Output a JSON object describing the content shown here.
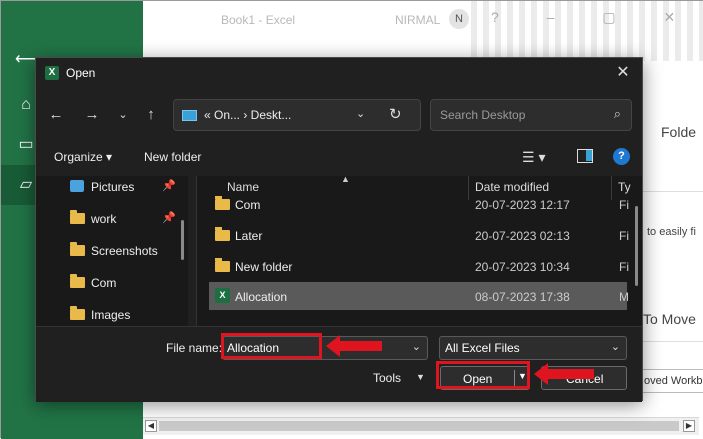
{
  "backstage": {
    "title": "Book1  -  Excel",
    "user": "NIRMAL",
    "avatar": "N",
    "window_controls": "?  –  ▢  ✕",
    "folder_heading": "Folde",
    "easily_text": "to easily fi",
    "to_move_text": "To Move",
    "moved_button": "oved Workb"
  },
  "dialog": {
    "title": "Open",
    "close_glyph": "✕",
    "address": {
      "path_text": "«  On...  ›  Deskt...",
      "dropdown_glyph": "⌄",
      "refresh_glyph": "↻"
    },
    "search": {
      "placeholder": "Search Desktop"
    },
    "toolbar": {
      "organize_label": "Organize ▾",
      "new_folder_label": "New folder",
      "help_glyph": "?"
    },
    "sidebar": {
      "items": [
        {
          "label": "Pictures",
          "icon": "pictures-icon",
          "pinned": true
        },
        {
          "label": "work",
          "icon": "folder-icon",
          "pinned": true
        },
        {
          "label": "Screenshots",
          "icon": "folder-icon",
          "pinned": false
        },
        {
          "label": "Com",
          "icon": "folder-icon",
          "pinned": false
        },
        {
          "label": "Images",
          "icon": "folder-icon",
          "pinned": false
        }
      ]
    },
    "columns": {
      "name": "Name",
      "date": "Date modified",
      "type": "Ty"
    },
    "files": [
      {
        "name": "Com",
        "date": "20-07-2023 12:17",
        "type": "Fi",
        "kind": "folder"
      },
      {
        "name": "Later",
        "date": "20-07-2023 02:13",
        "type": "Fi",
        "kind": "folder"
      },
      {
        "name": "New folder",
        "date": "20-07-2023 10:34",
        "type": "Fi",
        "kind": "folder"
      },
      {
        "name": "Allocation",
        "date": "08-07-2023 17:38",
        "type": "M",
        "kind": "excel",
        "selected": true
      }
    ],
    "bottom": {
      "file_name_label": "File name:",
      "file_name_value": "Allocation",
      "file_type_value": "All Excel Files",
      "tools_label": "Tools",
      "open_label": "Open",
      "cancel_label": "Cancel"
    }
  },
  "colors": {
    "excel_green": "#217346",
    "annotation_red": "#e0141e",
    "dialog_bg": "#202020"
  }
}
